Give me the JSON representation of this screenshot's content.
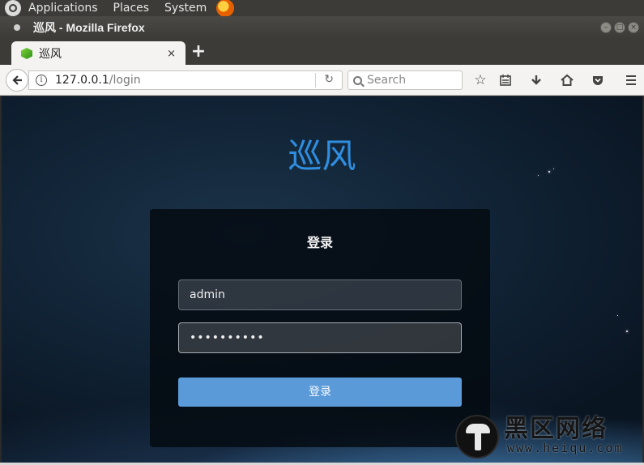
{
  "system_panel": {
    "menus": [
      "Applications",
      "Places",
      "System"
    ]
  },
  "window": {
    "title": "巡风 - Mozilla Firefox"
  },
  "tabs": [
    {
      "label": "巡风"
    }
  ],
  "tab_close": "×",
  "new_tab": "+",
  "url": {
    "host": "127.0.0.1",
    "path": "/login"
  },
  "search": {
    "placeholder": "Search"
  },
  "page": {
    "brand": "巡风",
    "login_heading": "登录",
    "username_value": "admin",
    "password_masked": "••••••••••",
    "submit_label": "登录"
  },
  "watermark": {
    "text": "黑区网络",
    "url": "www.heiqu.com"
  },
  "colors": {
    "brand": "#2f8ee0",
    "button": "#5b9ad8"
  }
}
